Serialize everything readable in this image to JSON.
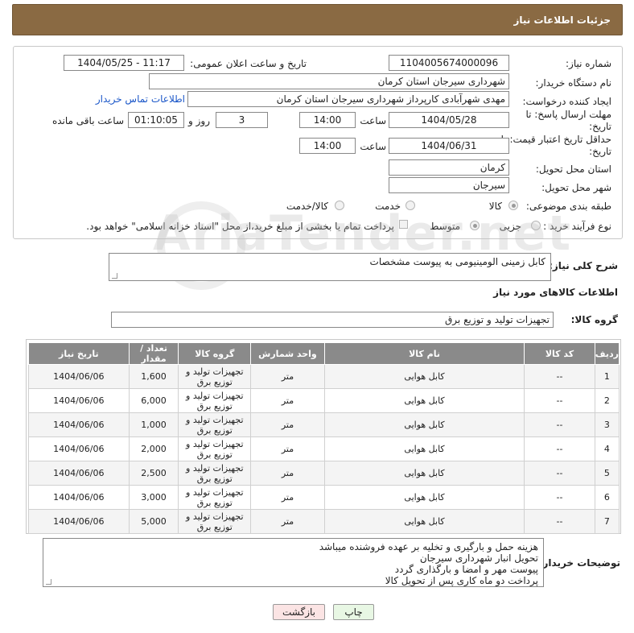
{
  "header": {
    "title": "جزئیات اطلاعات نیاز"
  },
  "form": {
    "need_number_label": "شماره نیاز:",
    "need_number": "1104005674000096",
    "announce_label": "تاریخ و ساعت اعلان عمومی:",
    "announce_value": "1404/05/25 - 11:17",
    "buyer_org_label": "نام دستگاه خریدار:",
    "buyer_org": "شهرداری سیرجان استان کرمان",
    "requester_label": "ایجاد کننده درخواست:",
    "requester": "مهدی شهرآبادی کارپرداز شهرداری سیرجان استان کرمان",
    "contact_link": "اطلاعات تماس خریدار",
    "deadline_label": "مهلت ارسال پاسخ: تا تاریخ:",
    "deadline_date": "1404/05/28",
    "time_label": "ساعت",
    "deadline_time": "14:00",
    "days_value": "3",
    "days_label": "روز و",
    "remaining_time": "01:10:05",
    "remaining_label": "ساعت باقی مانده",
    "price_valid_label": "حداقل تاریخ اعتبار قیمت: تا تاریخ:",
    "price_valid_date": "1404/06/31",
    "price_valid_time": "14:00",
    "province_label": "استان محل تحویل:",
    "province": "کرمان",
    "city_label": "شهر محل تحویل:",
    "city": "سیرجان",
    "category_label": "طبقه بندی موضوعی:",
    "category_options": [
      "کالا",
      "خدمت",
      "کالا/خدمت"
    ],
    "process_label": "نوع فرآیند خرید :",
    "process_options": [
      "جزیی",
      "متوسط"
    ],
    "process_note": "پرداخت تمام یا بخشی از مبلغ خرید،از محل \"اسناد خزانه اسلامی\" خواهد بود."
  },
  "description": {
    "label": "شرح کلی نیاز:",
    "value": "کابل زمینی الومینیومی به پیوست مشخصات"
  },
  "goods_section": {
    "title": "اطلاعات کالاهای مورد نیاز",
    "group_label": "گروه کالا:",
    "group_value": "تجهیزات تولید و توزیع برق"
  },
  "table": {
    "headers": [
      "ردیف",
      "کد کالا",
      "نام کالا",
      "واحد شمارش",
      "گروه کالا",
      "تعداد / مقدار",
      "تاریخ نیاز"
    ],
    "rows": [
      {
        "row": "1",
        "code": "--",
        "name": "کابل هوایی",
        "unit": "متر",
        "group": "تجهیزات تولید و توزیع برق",
        "qty": "1,600",
        "date": "1404/06/06"
      },
      {
        "row": "2",
        "code": "--",
        "name": "کابل هوایی",
        "unit": "متر",
        "group": "تجهیزات تولید و توزیع برق",
        "qty": "6,000",
        "date": "1404/06/06"
      },
      {
        "row": "3",
        "code": "--",
        "name": "کابل هوایی",
        "unit": "متر",
        "group": "تجهیزات تولید و توزیع برق",
        "qty": "1,000",
        "date": "1404/06/06"
      },
      {
        "row": "4",
        "code": "--",
        "name": "کابل هوایی",
        "unit": "متر",
        "group": "تجهیزات تولید و توزیع برق",
        "qty": "2,000",
        "date": "1404/06/06"
      },
      {
        "row": "5",
        "code": "--",
        "name": "کابل هوایی",
        "unit": "متر",
        "group": "تجهیزات تولید و توزیع برق",
        "qty": "2,500",
        "date": "1404/06/06"
      },
      {
        "row": "6",
        "code": "--",
        "name": "کابل هوایی",
        "unit": "متر",
        "group": "تجهیزات تولید و توزیع برق",
        "qty": "3,000",
        "date": "1404/06/06"
      },
      {
        "row": "7",
        "code": "--",
        "name": "کابل هوایی",
        "unit": "متر",
        "group": "تجهیزات تولید و توزیع برق",
        "qty": "5,000",
        "date": "1404/06/06"
      }
    ]
  },
  "buyer_notes": {
    "label": "توضیحات خریدار:",
    "lines": [
      "هزینه حمل و بارگیری و تخلیه بر عهده فروشنده میباشد",
      "تحویل انبار شهرداری سیرجان",
      "پیوست مهر و امضا و بارگذاری گردد",
      "پرداخت دو ماه کاری پس از تحویل کالا"
    ]
  },
  "buttons": {
    "print": "چاپ",
    "back": "بازگشت"
  },
  "watermark": "AriaTender.net",
  "colors": {
    "header_bg": "#8a6a43",
    "table_header_bg": "#8a8a8a",
    "link": "#1a56c8",
    "back_button_bg": "#fbe4e4",
    "print_button_bg": "#e8f7e4"
  }
}
